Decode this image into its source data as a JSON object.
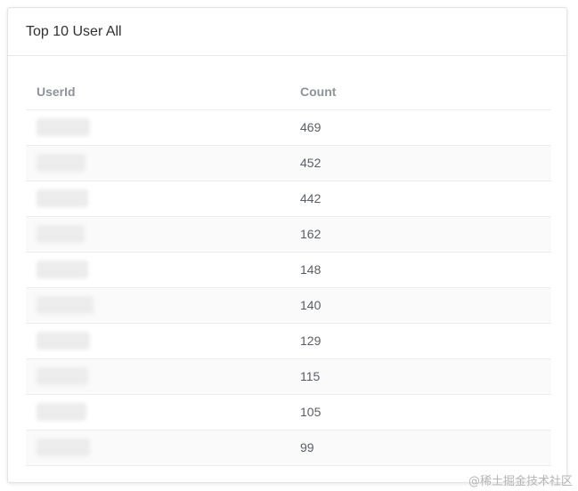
{
  "card": {
    "title": "Top 10 User All"
  },
  "table": {
    "headers": [
      "UserId",
      "Count"
    ],
    "rows": [
      {
        "userid_redacted": true,
        "count": "469"
      },
      {
        "userid_redacted": true,
        "count": "452"
      },
      {
        "userid_redacted": true,
        "count": "442"
      },
      {
        "userid_redacted": true,
        "count": "162"
      },
      {
        "userid_redacted": true,
        "count": "148"
      },
      {
        "userid_redacted": true,
        "count": "140"
      },
      {
        "userid_redacted": true,
        "count": "129"
      },
      {
        "userid_redacted": true,
        "count": "115"
      },
      {
        "userid_redacted": true,
        "count": "105"
      },
      {
        "userid_redacted": true,
        "count": "99"
      }
    ]
  },
  "watermark": "@稀土掘金技术社区",
  "colors": {
    "stripe": "#fafafa",
    "border": "#ebeef5",
    "header_text": "#8f9399",
    "cell_text": "#5a5e66"
  }
}
